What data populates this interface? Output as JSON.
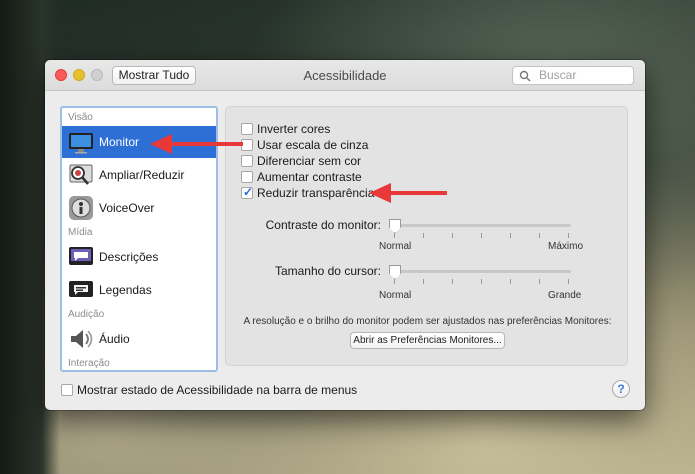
{
  "window": {
    "title": "Acessibilidade",
    "show_all_label": "Mostrar Tudo",
    "search_placeholder": "Buscar"
  },
  "sidebar": {
    "sections": [
      "Visão",
      "Mídia",
      "Audição",
      "Interação"
    ],
    "items": [
      {
        "label": "Monitor",
        "icon": "monitor-icon",
        "selected": true
      },
      {
        "label": "Ampliar/Reduzir",
        "icon": "zoom-icon"
      },
      {
        "label": "VoiceOver",
        "icon": "voiceover-icon"
      },
      {
        "label": "Descrições",
        "icon": "descriptions-icon"
      },
      {
        "label": "Legendas",
        "icon": "captions-icon"
      },
      {
        "label": "Áudio",
        "icon": "speaker-icon"
      }
    ]
  },
  "options": [
    {
      "label": "Inverter cores",
      "checked": false
    },
    {
      "label": "Usar escala de cinza",
      "checked": false
    },
    {
      "label": "Diferenciar sem cor",
      "checked": false
    },
    {
      "label": "Aumentar contraste",
      "checked": false
    },
    {
      "label": "Reduzir transparência",
      "checked": true
    }
  ],
  "sliders": {
    "contrast": {
      "label": "Contraste do monitor:",
      "min_label": "Normal",
      "max_label": "Máximo",
      "value": 0
    },
    "cursor": {
      "label": "Tamanho do cursor:",
      "min_label": "Normal",
      "max_label": "Grande",
      "value": 0
    }
  },
  "info_text": "A resolução e o brilho do monitor podem ser ajustados nas preferências Monitores:",
  "open_prefs_label": "Abrir as Preferências Monitores...",
  "bottom_checkbox_label": "Mostrar estado de Acessibilidade na barra de menus",
  "help_label": "?",
  "colors": {
    "accent": "#2e6fd6",
    "annotation_arrow": "#e8383a"
  }
}
